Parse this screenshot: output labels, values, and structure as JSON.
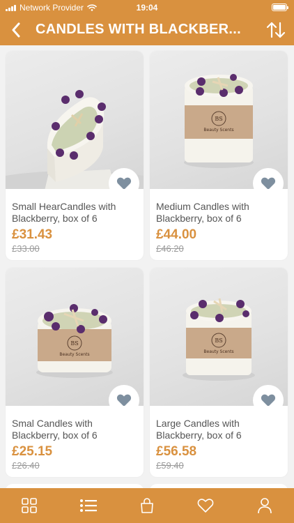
{
  "status": {
    "carrier": "Network Provider",
    "time": "19:04"
  },
  "header": {
    "title": "CANDLES WITH BLACKBER..."
  },
  "products": [
    {
      "name": "Small HearCandles with Blackberry, box of 6",
      "price": "£31.43",
      "old_price": "£33.00",
      "favorite": false
    },
    {
      "name": "Medium Candles with Blackberry, box of 6",
      "price": "£44.00",
      "old_price": "£46.20",
      "favorite": false
    },
    {
      "name": "Smal Candles with Blackberry, box of 6",
      "price": "£25.15",
      "old_price": "£26.40",
      "favorite": false
    },
    {
      "name": "Large Candles with Blackberry, box of 6",
      "price": "£56.58",
      "old_price": "£59.40",
      "favorite": false
    }
  ],
  "tabbar": {
    "tabs": [
      {
        "icon": "grid-icon",
        "active": false
      },
      {
        "icon": "list-icon",
        "active": true
      },
      {
        "icon": "bag-icon",
        "active": false
      },
      {
        "icon": "heart-icon",
        "active": false
      },
      {
        "icon": "user-icon",
        "active": false
      }
    ]
  },
  "colors": {
    "accent": "#d9913f",
    "heart": "#7e8f9f",
    "background": "#f2f2f2"
  }
}
